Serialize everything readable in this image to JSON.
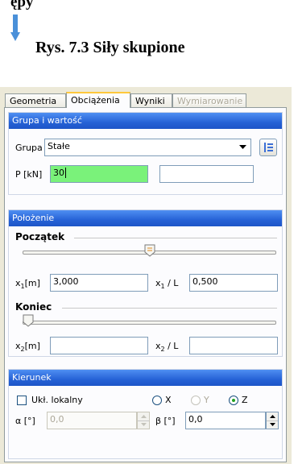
{
  "document": {
    "cut_line": "ępy",
    "caption": "Rys. 7.3 Siły skupione"
  },
  "tabs": [
    {
      "label": "Geometria",
      "state": "normal"
    },
    {
      "label": "Obciążenia",
      "state": "active"
    },
    {
      "label": "Wyniki",
      "state": "normal"
    },
    {
      "label": "Wymiarowanie",
      "state": "disabled"
    }
  ],
  "group_value": {
    "header": "Grupa i wartość",
    "group_label": "Grupa",
    "group_selected": "Stałe",
    "p_label": "P [kN]",
    "p_value": "30",
    "p_aux_value": ""
  },
  "position": {
    "header": "Położenie",
    "start_heading": "Początek",
    "start_slider_fraction": 0.5,
    "x1m_label": "x1[m]",
    "x1m_value": "3,000",
    "x1l_label": "x1 / L",
    "x1l_value": "0,500",
    "end_heading": "Koniec",
    "end_slider_fraction": 0.0,
    "x2m_label": "x2[m]",
    "x2m_value": "",
    "x2l_label": "x2 / L",
    "x2l_value": ""
  },
  "direction": {
    "header": "Kierunek",
    "local_label": "Ukł. lokalny",
    "local_checked": false,
    "options": [
      {
        "label": "X",
        "enabled": true,
        "selected": false
      },
      {
        "label": "Y",
        "enabled": false,
        "selected": false
      },
      {
        "label": "Z",
        "enabled": true,
        "selected": true
      }
    ],
    "alpha_label": "α [°]",
    "alpha_value": "0,0",
    "beta_label": "β [°]",
    "beta_value": "0,0"
  },
  "colors": {
    "header_blue": "#2662d6",
    "active_field_green": "#7af27a",
    "arrow_blue": "#4a90d9"
  }
}
